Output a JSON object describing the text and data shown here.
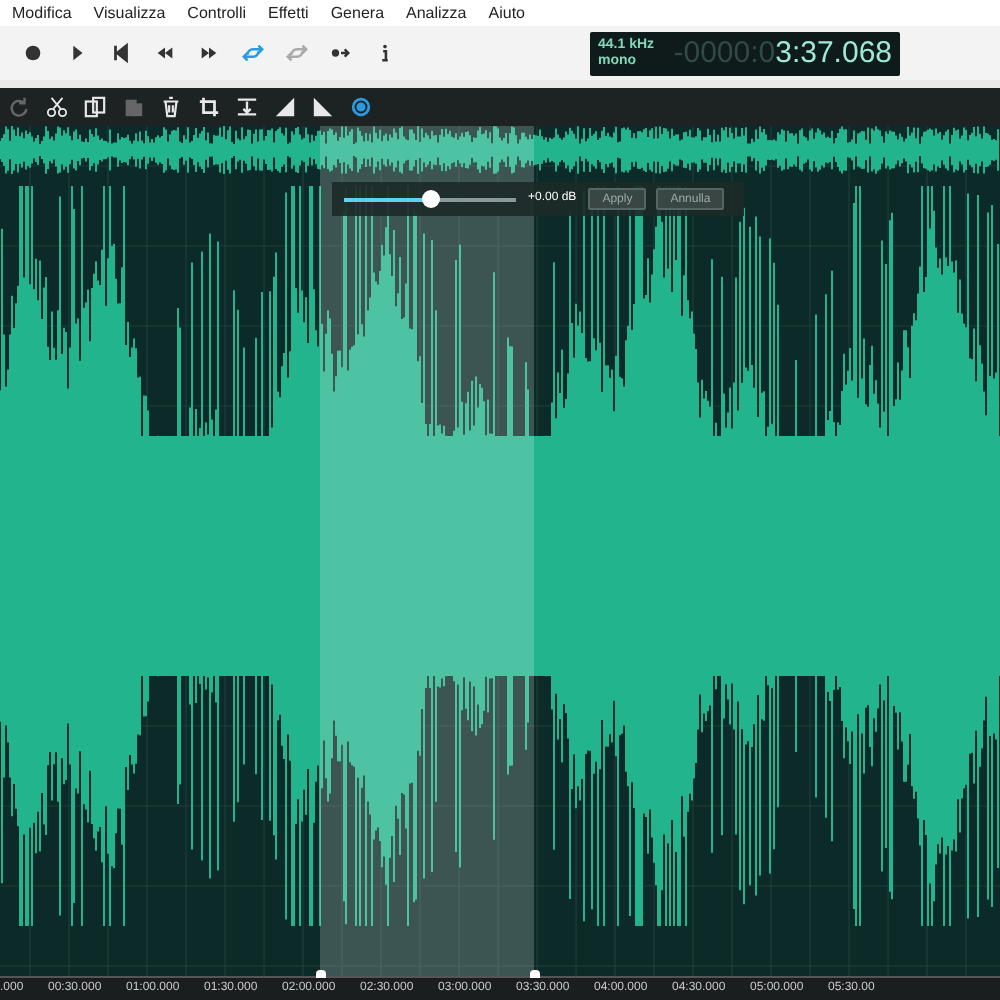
{
  "menu": [
    "Modifica",
    "Visualizza",
    "Controlli",
    "Effetti",
    "Genera",
    "Analizza",
    "Aiuto"
  ],
  "transport": [
    {
      "kind": "record",
      "active": false,
      "disabled": false
    },
    {
      "kind": "play",
      "active": false,
      "disabled": false
    },
    {
      "kind": "start",
      "active": false,
      "disabled": false
    },
    {
      "kind": "rewind",
      "active": false,
      "disabled": false
    },
    {
      "kind": "forward",
      "active": false,
      "disabled": false
    },
    {
      "kind": "loop",
      "active": true,
      "disabled": false
    },
    {
      "kind": "loop",
      "active": false,
      "disabled": true
    },
    {
      "kind": "dotarrow",
      "active": false,
      "disabled": false
    },
    {
      "kind": "info",
      "active": false,
      "disabled": false
    }
  ],
  "display": {
    "rate": "44.1 kHz",
    "channels": "mono",
    "time_dim": "-0000:0",
    "time": "3:37.068"
  },
  "edit_tools": [
    {
      "kind": "redo",
      "active": false,
      "disabled": true
    },
    {
      "kind": "cut",
      "active": false,
      "disabled": false
    },
    {
      "kind": "copy",
      "active": false,
      "disabled": false
    },
    {
      "kind": "paste",
      "active": false,
      "disabled": true
    },
    {
      "kind": "delete",
      "active": false,
      "disabled": false
    },
    {
      "kind": "crop",
      "active": false,
      "disabled": false
    },
    {
      "kind": "normalize",
      "active": false,
      "disabled": false
    },
    {
      "kind": "fadein",
      "active": false,
      "disabled": false
    },
    {
      "kind": "fadeout",
      "active": false,
      "disabled": false
    },
    {
      "kind": "effect",
      "active": true,
      "disabled": false
    }
  ],
  "gain": {
    "level": 0.5,
    "reading": "+0.00 dB",
    "buttons": [
      "Apply",
      "Annulla"
    ]
  },
  "timeline": [
    ".000",
    "00:30.000",
    "01:00.000",
    "01:30.000",
    "02:00.000",
    "02:30.000",
    "03:00.000",
    "03:30.000",
    "04:00.000",
    "04:30.000",
    "05:00.000",
    "05:30.00"
  ]
}
